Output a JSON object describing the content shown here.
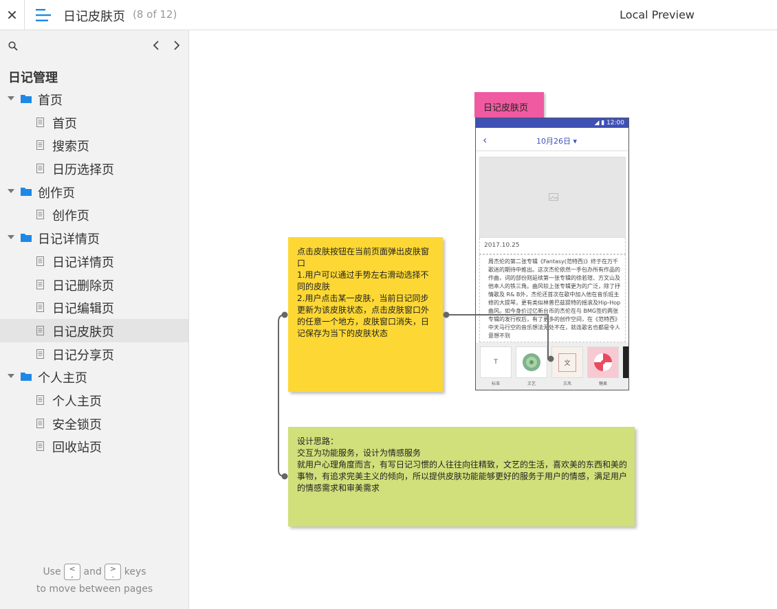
{
  "topbar": {
    "close_label": "✕",
    "title": "日记皮肤页",
    "count": "(8 of 12)",
    "preview_label": "Local Preview"
  },
  "sidebar": {
    "root_label": "日记管理",
    "items": [
      {
        "type": "folder",
        "label": "首页"
      },
      {
        "type": "page",
        "label": "首页"
      },
      {
        "type": "page",
        "label": "搜索页"
      },
      {
        "type": "page",
        "label": "日历选择页"
      },
      {
        "type": "folder",
        "label": "创作页"
      },
      {
        "type": "page",
        "label": "创作页"
      },
      {
        "type": "folder",
        "label": "日记详情页"
      },
      {
        "type": "page",
        "label": "日记详情页"
      },
      {
        "type": "page",
        "label": "日记删除页"
      },
      {
        "type": "page",
        "label": "日记编辑页"
      },
      {
        "type": "page",
        "label": "日记皮肤页",
        "active": true
      },
      {
        "type": "page",
        "label": "日记分享页"
      },
      {
        "type": "folder",
        "label": "个人主页"
      },
      {
        "type": "page",
        "label": "个人主页"
      },
      {
        "type": "page",
        "label": "安全锁页"
      },
      {
        "type": "page",
        "label": "回收站页"
      }
    ],
    "hint": {
      "use": "Use",
      "key_prev": "<\n,",
      "and": "and",
      "key_next": ">\n.",
      "keys": "keys",
      "line2": "to move between pages"
    }
  },
  "canvas": {
    "tag_label": "日记皮肤页",
    "phone": {
      "time": "12:00",
      "date": "10月26日",
      "card_date": "2017.10.25",
      "body_text": "周杰伦的第二张专辑《Fantasy(范特西)》终于在万千歌迷的期待中推出。这次杰伦依然一手包办所有作品的作曲，词的部份则延续第一张专辑的徐若瑄、方文山及他本人的铁三角。曲风较上张专辑更为的广泛，除了抒情歌及 R& B外，杰伦还首次在歌中加入他在音乐班主修的大提琴，更有类似林普巴兹提特的摇滚及Hip-Hop曲风。如今身价过亿新台币的杰伦在与 BMG签约两张专辑的发行权后，有了更多的创作空间，在《范特西》中天马行空的音乐想法无处不在，就连歌名也都是令人意想不到",
      "skins": [
        {
          "glyph": "T",
          "label": "标准"
        },
        {
          "glyph": "",
          "label": "文艺"
        },
        {
          "glyph": "文",
          "label": "古风"
        },
        {
          "glyph": "",
          "label": "糖果"
        }
      ]
    },
    "note_yellow": "点击皮肤按钮在当前页面弹出皮肤窗口\n1.用户可以通过手势左右滑动选择不同的皮肤\n2.用户点击某一皮肤，当前日记同步更新为该皮肤状态，点击皮肤窗口外的任意一个地方，皮肤窗口消失，日记保存为当下的皮肤状态",
    "note_green": "设计思路：\n交互为功能服务，设计为情感服务\n就用户心理角度而言，有写日记习惯的人往往向往精致，文艺的生活，喜欢美的东西和美的事物，有追求完美主义的倾向，所以提供皮肤功能能够更好的服务于用户的情感，满足用户的情感需求和审美需求"
  },
  "colors": {
    "accent_blue": "#1e88e5",
    "tag_pink": "#ef5aa0",
    "note_yellow": "#fdd835",
    "note_green": "#d1e07a",
    "phone_bar": "#3f51b5"
  }
}
